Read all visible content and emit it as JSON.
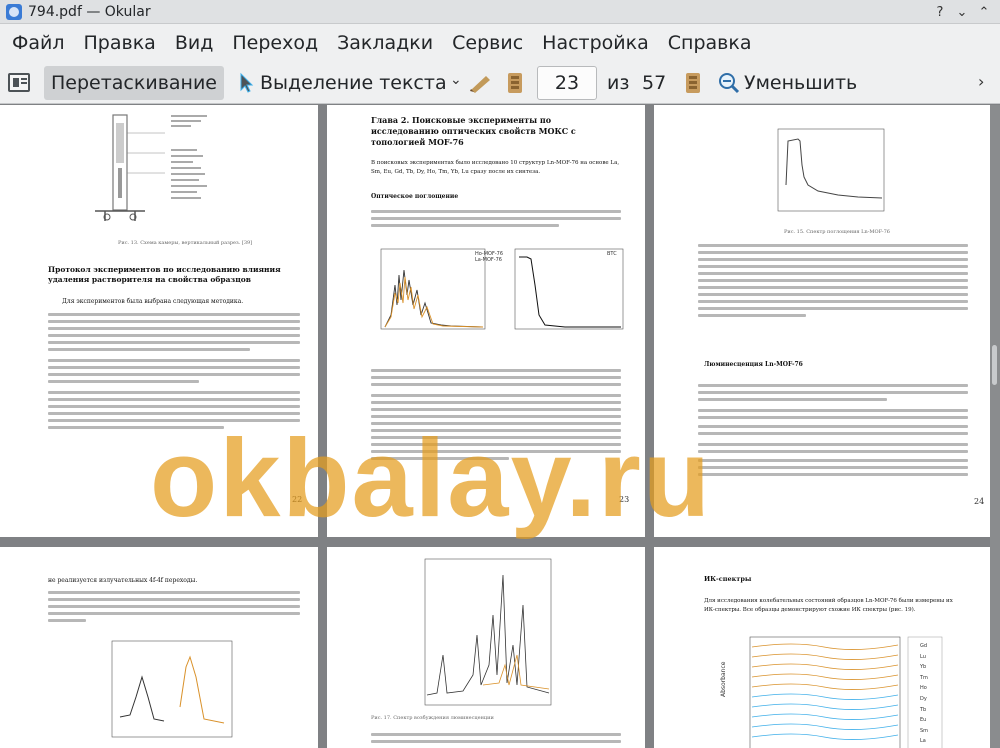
{
  "window": {
    "title": "794.pdf  — Okular"
  },
  "menubar": {
    "items": [
      "Файл",
      "Правка",
      "Вид",
      "Переход",
      "Закладки",
      "Сервис",
      "Настройка",
      "Справка"
    ]
  },
  "toolbar": {
    "drag_label": "Перетаскивание",
    "select_label": "Выделение текста",
    "page_value": "23",
    "of_label": "из",
    "total_pages": "57",
    "zoom_out_label": "Уменьшить"
  },
  "pages": {
    "p22": {
      "caption": "Рис. 13. Схема камеры, вертикальный разрез. [39]",
      "heading": "Протокол экспериментов по исследованию влияния удаления растворителя на свойства образцов",
      "intro": "Для экспериментов была выбрана следующая методика.",
      "number": "22"
    },
    "p23": {
      "heading": "Глава 2. Поисковые эксперименты по исследованию оптических свойств МОКС с топологией MOF-76",
      "intro": "В поисковых экспериментах было исследовано 10 структур Ln-MOF-76 на основе La, Sm, Eu, Gd, Tb, Dy, Ho, Tm, Yb, Lu сразу после их синтеза.",
      "subheading": "Оптическое поглощение",
      "legend_a": [
        "Ho-MOF-76",
        "La-MOF-76"
      ],
      "legend_b": "BTC",
      "number": "23"
    },
    "p24": {
      "caption": "Рис. 15. Спектр поглощения Ln-MOF-76",
      "subheading": "Люминесценция Ln-MOF-76",
      "number": "24"
    },
    "p25": {
      "text": "не реализуется излучательных 4f-4f переходы."
    },
    "p26": {
      "caption": "Рис. 17. Спектр возбуждения люминесценции"
    },
    "p27": {
      "heading": "ИК-спектры",
      "intro": "Для исследования колебательных состояний образцов Ln-MOF-76 были измерены их ИК-спектры. Все образцы демонстрируют схожие ИК спектры (рис. 19).",
      "legend": [
        "Gd",
        "Lu",
        "Yb",
        "Tm",
        "Ho",
        "Dy",
        "Tb",
        "Eu",
        "Sm",
        "La"
      ],
      "ylabel": "Absorbance"
    }
  },
  "watermark": {
    "text": "okbalay.ru"
  },
  "colors": {
    "accent": "#3daee9",
    "watermark": "#e59d1d",
    "orange_series": "#d9912a"
  }
}
